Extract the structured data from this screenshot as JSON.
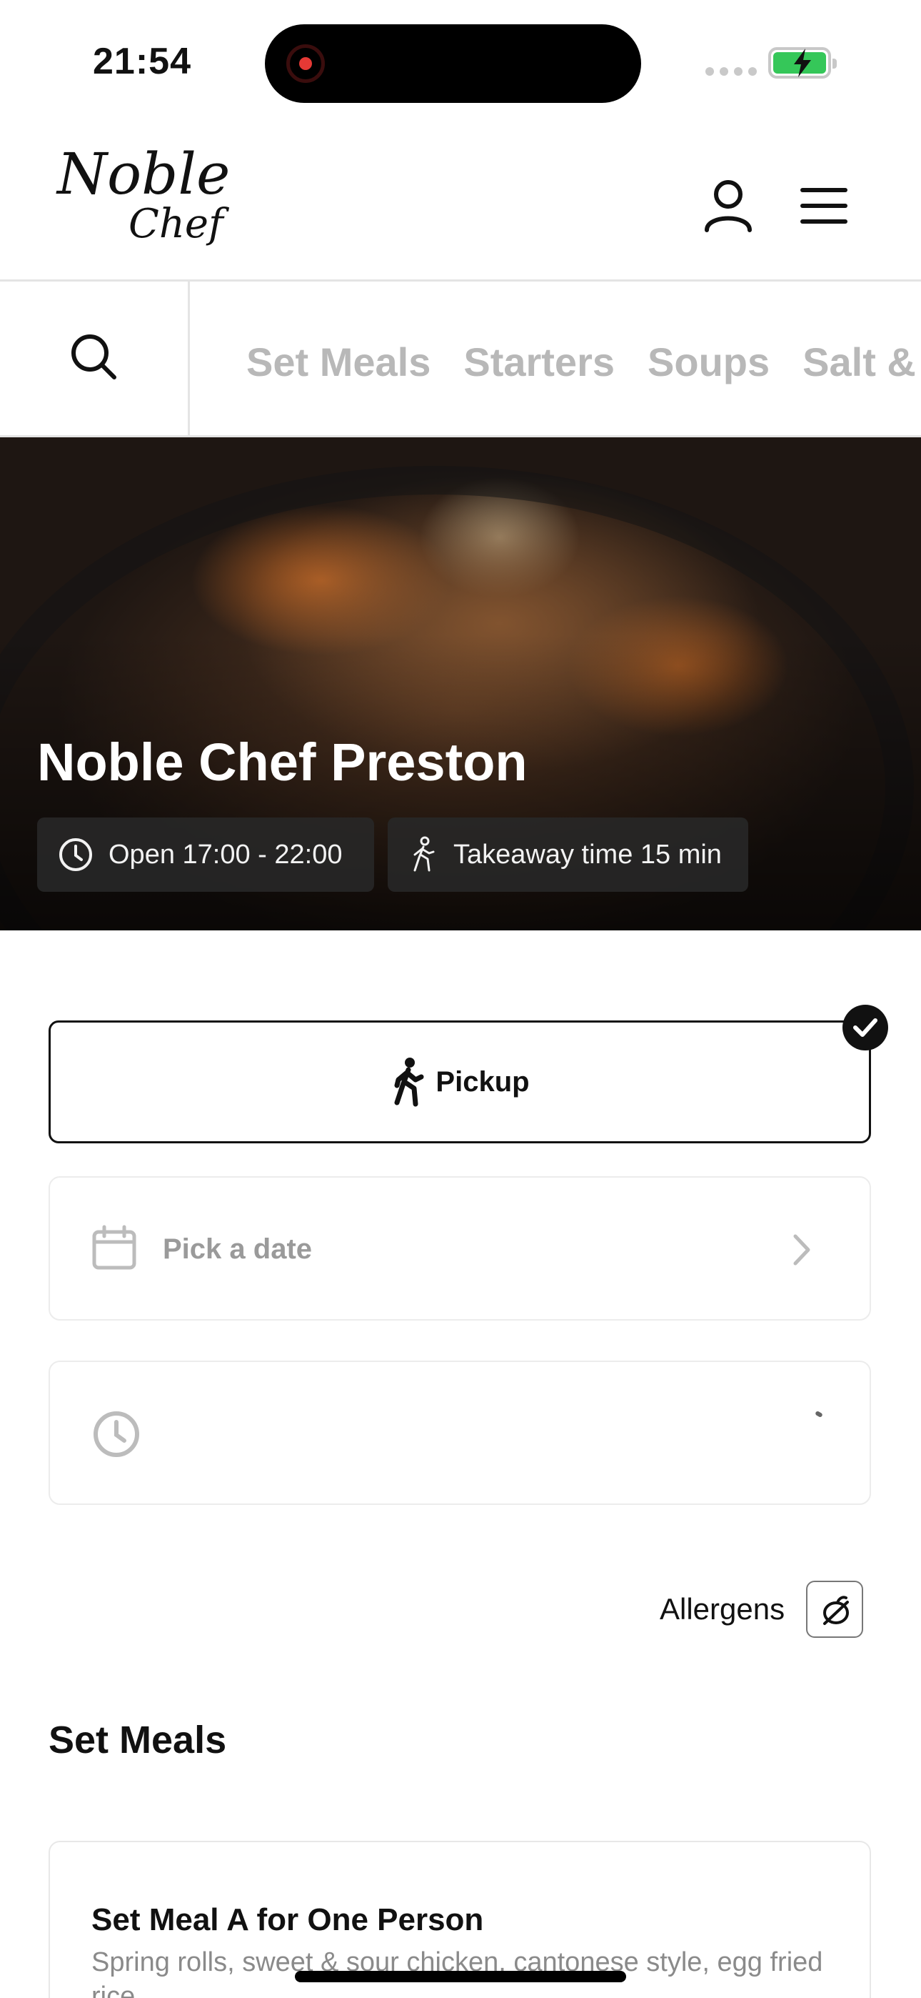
{
  "status_bar": {
    "time": "21:54"
  },
  "header": {
    "logo_line1": "Noble",
    "logo_line2": "Chef"
  },
  "category_nav": {
    "tabs": [
      "Set Meals",
      "Starters",
      "Soups",
      "Salt & Pepper"
    ]
  },
  "hero": {
    "title": "Noble Chef Preston",
    "open_hours": "Open 17:00 - 22:00",
    "takeaway_time": "Takeaway time 15 min"
  },
  "order": {
    "mode_label": "Pickup",
    "date_placeholder": "Pick a date"
  },
  "allergens": {
    "label": "Allergens"
  },
  "menu": {
    "section_title": "Set Meals",
    "items": [
      {
        "name": "Set Meal A for One Person",
        "description": "Spring rolls, sweet & sour chicken, cantonese style, egg fried rice"
      }
    ]
  },
  "colors": {
    "accent": "#111111",
    "muted_text": "#9a9a9a",
    "tab_inactive": "#b8b8b8",
    "battery": "#35c759"
  }
}
